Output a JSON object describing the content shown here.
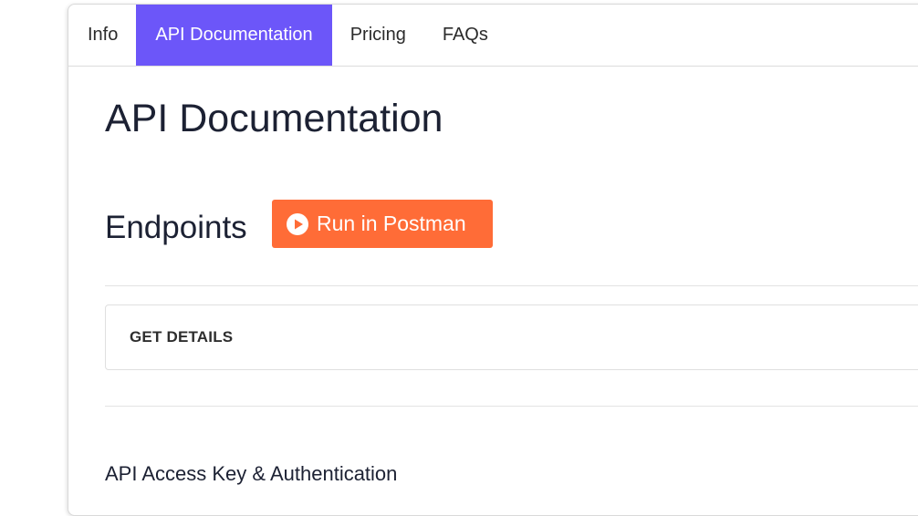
{
  "tabs": [
    {
      "label": "Info",
      "active": false
    },
    {
      "label": "API Documentation",
      "active": true
    },
    {
      "label": "Pricing",
      "active": false
    },
    {
      "label": "FAQs",
      "active": false
    }
  ],
  "main": {
    "title": "API Documentation",
    "endpoints_heading": "Endpoints",
    "run_button": {
      "label": "Run in Postman",
      "icon": "play-circle-icon"
    },
    "endpoint_items": [
      {
        "label": "GET DETAILS"
      }
    ],
    "next_section_heading": "API Access Key & Authentication"
  },
  "colors": {
    "active_tab": "#6c56f9",
    "postman_orange": "#ff6c37",
    "heading_text": "#1c2133"
  }
}
